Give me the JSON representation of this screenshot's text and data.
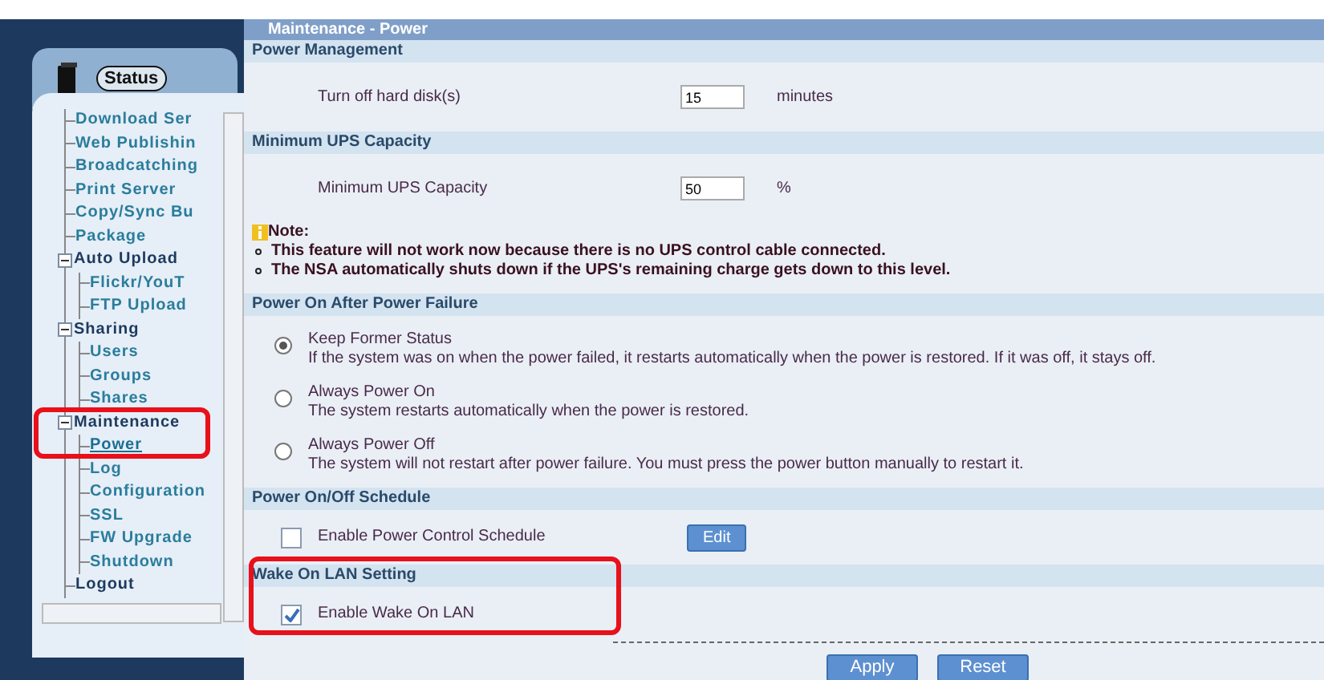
{
  "sidebar": {
    "status_tab": {
      "label": "Status"
    },
    "tree": [
      {
        "label": "Download Ser"
      },
      {
        "label": "Web Publishin"
      },
      {
        "label": "Broadcatching"
      },
      {
        "label": "Print Server"
      },
      {
        "label": "Copy/Sync Bu"
      },
      {
        "label": "Package"
      },
      {
        "label": "Auto Upload",
        "expanded": true,
        "selected": false,
        "children": [
          {
            "label": "Flickr/YouT",
            "selected": false
          },
          {
            "label": "FTP Upload",
            "selected": false
          }
        ]
      },
      {
        "label": "Sharing",
        "expanded": true,
        "selected": false,
        "children": [
          {
            "label": "Users",
            "selected": false
          },
          {
            "label": "Groups",
            "selected": false
          },
          {
            "label": "Shares",
            "selected": false
          }
        ]
      },
      {
        "label": "Maintenance",
        "expanded": true,
        "highlighted": true,
        "selected": false,
        "children": [
          {
            "label": "Power",
            "selected": true
          },
          {
            "label": "Log",
            "selected": false
          },
          {
            "label": "Configuration",
            "selected": false
          },
          {
            "label": "SSL",
            "selected": false
          },
          {
            "label": "FW Upgrade",
            "selected": false
          },
          {
            "label": "Shutdown",
            "selected": false
          }
        ]
      },
      {
        "label": "Logout"
      }
    ]
  },
  "page_title": "Maintenance - Power",
  "sections": [
    {
      "kind": "fields",
      "title": "Power Management",
      "fields": [
        {
          "label": "Turn off hard disk(s)",
          "value": "15",
          "unit": "minutes"
        }
      ]
    },
    {
      "kind": "fields",
      "title": "Minimum UPS Capacity",
      "fields": [
        {
          "label": "Minimum UPS Capacity",
          "value": "50",
          "unit": "%"
        }
      ],
      "note": {
        "title": "Note:",
        "items": [
          "This feature will not work now because there is no UPS control cable connected.",
          "The NSA automatically shuts down if the UPS's remaining charge gets down to this level."
        ]
      }
    },
    {
      "kind": "radios",
      "title": "Power On After Power Failure",
      "options": [
        {
          "label": "Keep Former Status",
          "description": "If the system was on when the power failed, it restarts automatically when the power is restored. If it was off, it stays off.",
          "selected": true
        },
        {
          "label": "Always Power On",
          "description": "The system restarts automatically when the power is restored.",
          "selected": false
        },
        {
          "label": "Always Power Off",
          "description": "The system will not restart after power failure. You must press the power button manually to restart it.",
          "selected": false
        }
      ]
    },
    {
      "kind": "checkbox",
      "title": "Power On/Off Schedule",
      "label": "Enable Power Control Schedule",
      "checked": false,
      "button": "Edit"
    },
    {
      "kind": "checkbox",
      "title": "Wake On LAN Setting",
      "highlighted": true,
      "label": "Enable Wake On LAN",
      "checked": true
    }
  ],
  "buttons": [
    "Apply",
    "Reset"
  ]
}
